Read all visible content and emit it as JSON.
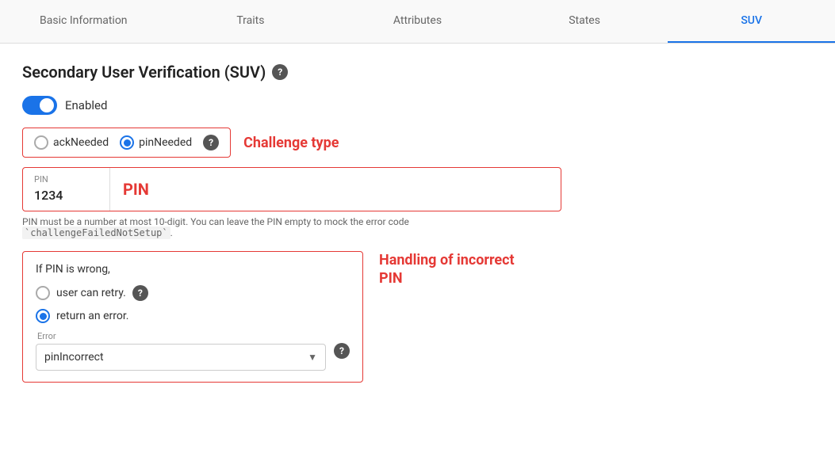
{
  "tabs": [
    {
      "id": "basic-information",
      "label": "Basic Information",
      "active": false
    },
    {
      "id": "traits",
      "label": "Traits",
      "active": false
    },
    {
      "id": "attributes",
      "label": "Attributes",
      "active": false
    },
    {
      "id": "states",
      "label": "States",
      "active": false
    },
    {
      "id": "suv",
      "label": "SUV",
      "active": true
    }
  ],
  "page": {
    "title": "Secondary User Verification (SUV)",
    "enabled_label": "Enabled",
    "challenge_type_label": "Challenge type",
    "challenge_options": [
      {
        "id": "ackNeeded",
        "label": "ackNeeded",
        "selected": false
      },
      {
        "id": "pinNeeded",
        "label": "pinNeeded",
        "selected": true
      }
    ],
    "pin_field_label": "PIN",
    "pin_value": "1234",
    "pin_section_label": "PIN",
    "pin_hint": "PIN must be a number at most 10-digit. You can leave the PIN empty to mock the error code `challengeFailedNotSetup`.",
    "handling_title": "If PIN is wrong,",
    "handling_label": "Handling of incorrect PIN",
    "handling_options": [
      {
        "id": "retry",
        "label": "user can retry.",
        "selected": false
      },
      {
        "id": "error",
        "label": "return an error.",
        "selected": true
      }
    ],
    "error_label": "Error",
    "error_value": "pinIncorrect"
  }
}
